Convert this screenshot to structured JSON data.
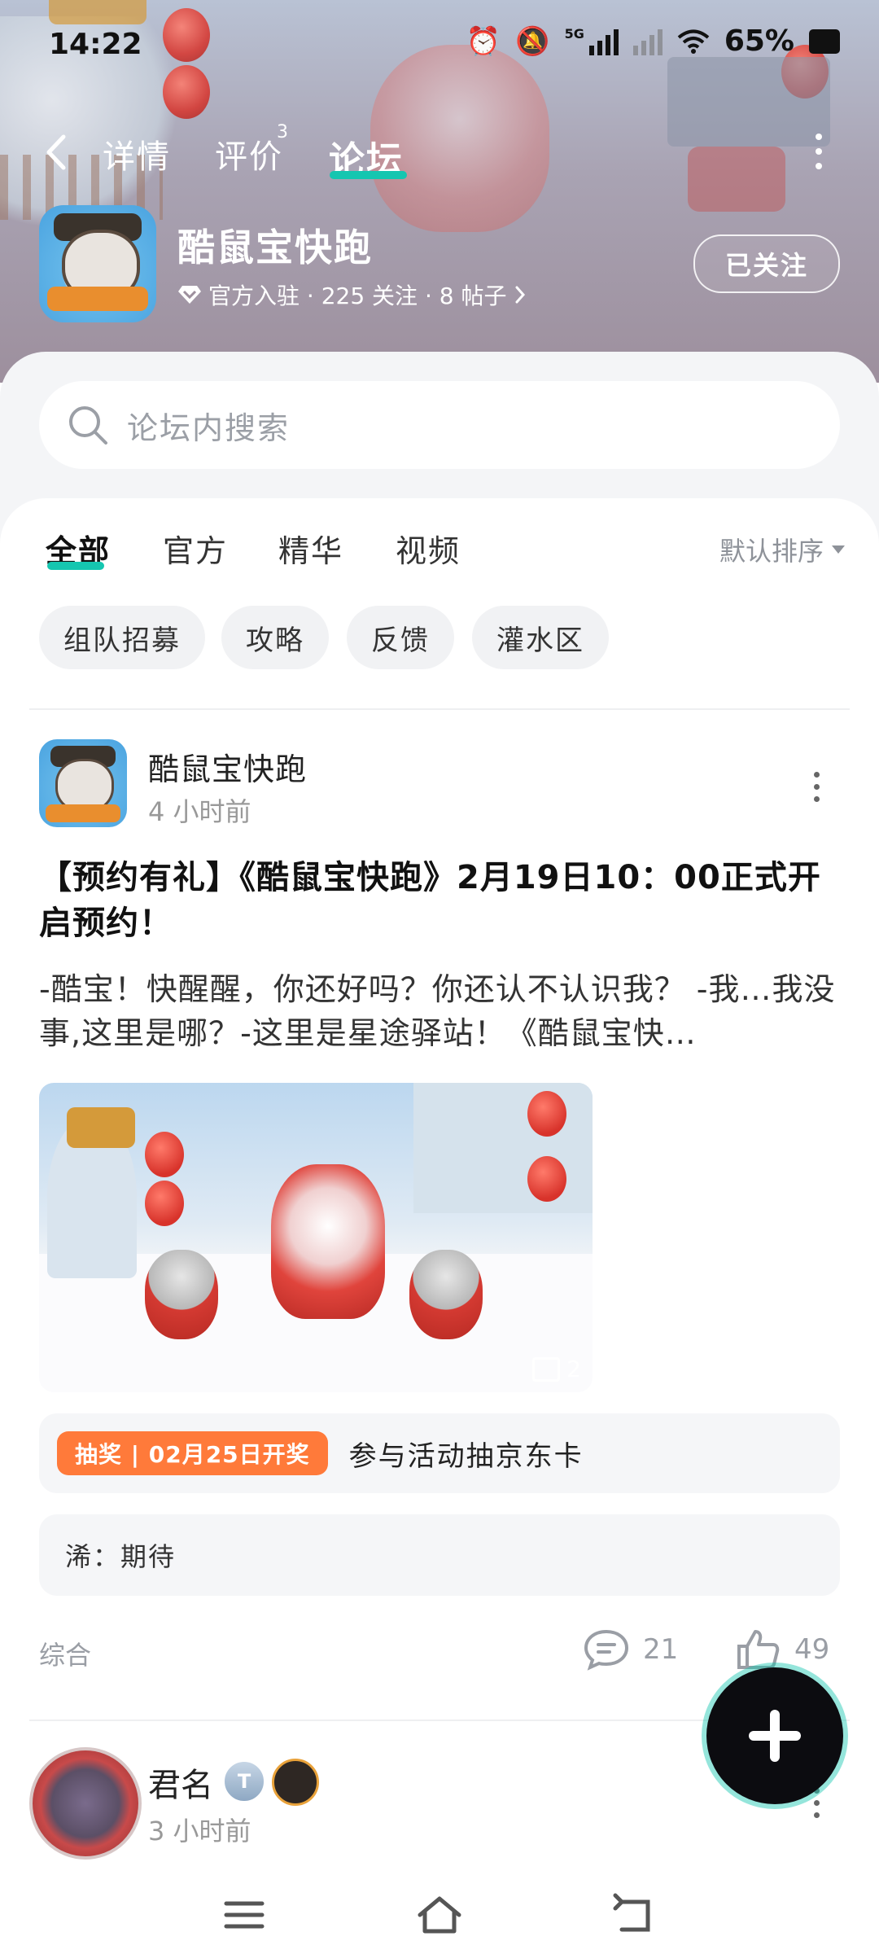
{
  "status_bar": {
    "time": "14:22",
    "network": "5G",
    "battery_percent": "65%",
    "icons": [
      "alarm-icon",
      "mute-icon",
      "signal-icon",
      "wifi-icon",
      "battery-icon"
    ]
  },
  "header": {
    "tabs": [
      {
        "label": "详情",
        "active": false
      },
      {
        "label": "评价",
        "active": false,
        "badge": "3"
      },
      {
        "label": "论坛",
        "active": true
      }
    ],
    "accent_color": "#15c6b0"
  },
  "game": {
    "title": "酷鼠宝快跑",
    "meta": "官方入驻 · 225 关注 · 8 帖子",
    "follow_label": "已关注"
  },
  "search": {
    "placeholder": "论坛内搜索"
  },
  "categories": {
    "tabs": [
      "全部",
      "官方",
      "精华",
      "视频"
    ],
    "active": "全部",
    "sort_label": "默认排序",
    "chips": [
      "组队招募",
      "攻略",
      "反馈",
      "灌水区"
    ]
  },
  "posts": [
    {
      "author": "酷鼠宝快跑",
      "time": "4 小时前",
      "title": "【预约有礼】《酷鼠宝快跑》2月19日10：00正式开启预约！",
      "excerpt": "-酷宝！快醒醒，你还好吗？你还认不认识我？ -我…我没事,这里是哪？-这里是星途驿站！《酷鼠宝快…",
      "image_count": "2",
      "lottery_tag": "抽奖 | 02月25日开奖",
      "lottery_text": "参与活动抽京东卡",
      "top_comment": "浠：期待",
      "footer_label": "综合",
      "comments": "21",
      "likes": "49"
    },
    {
      "author": "君名",
      "time": "3 小时前"
    }
  ]
}
